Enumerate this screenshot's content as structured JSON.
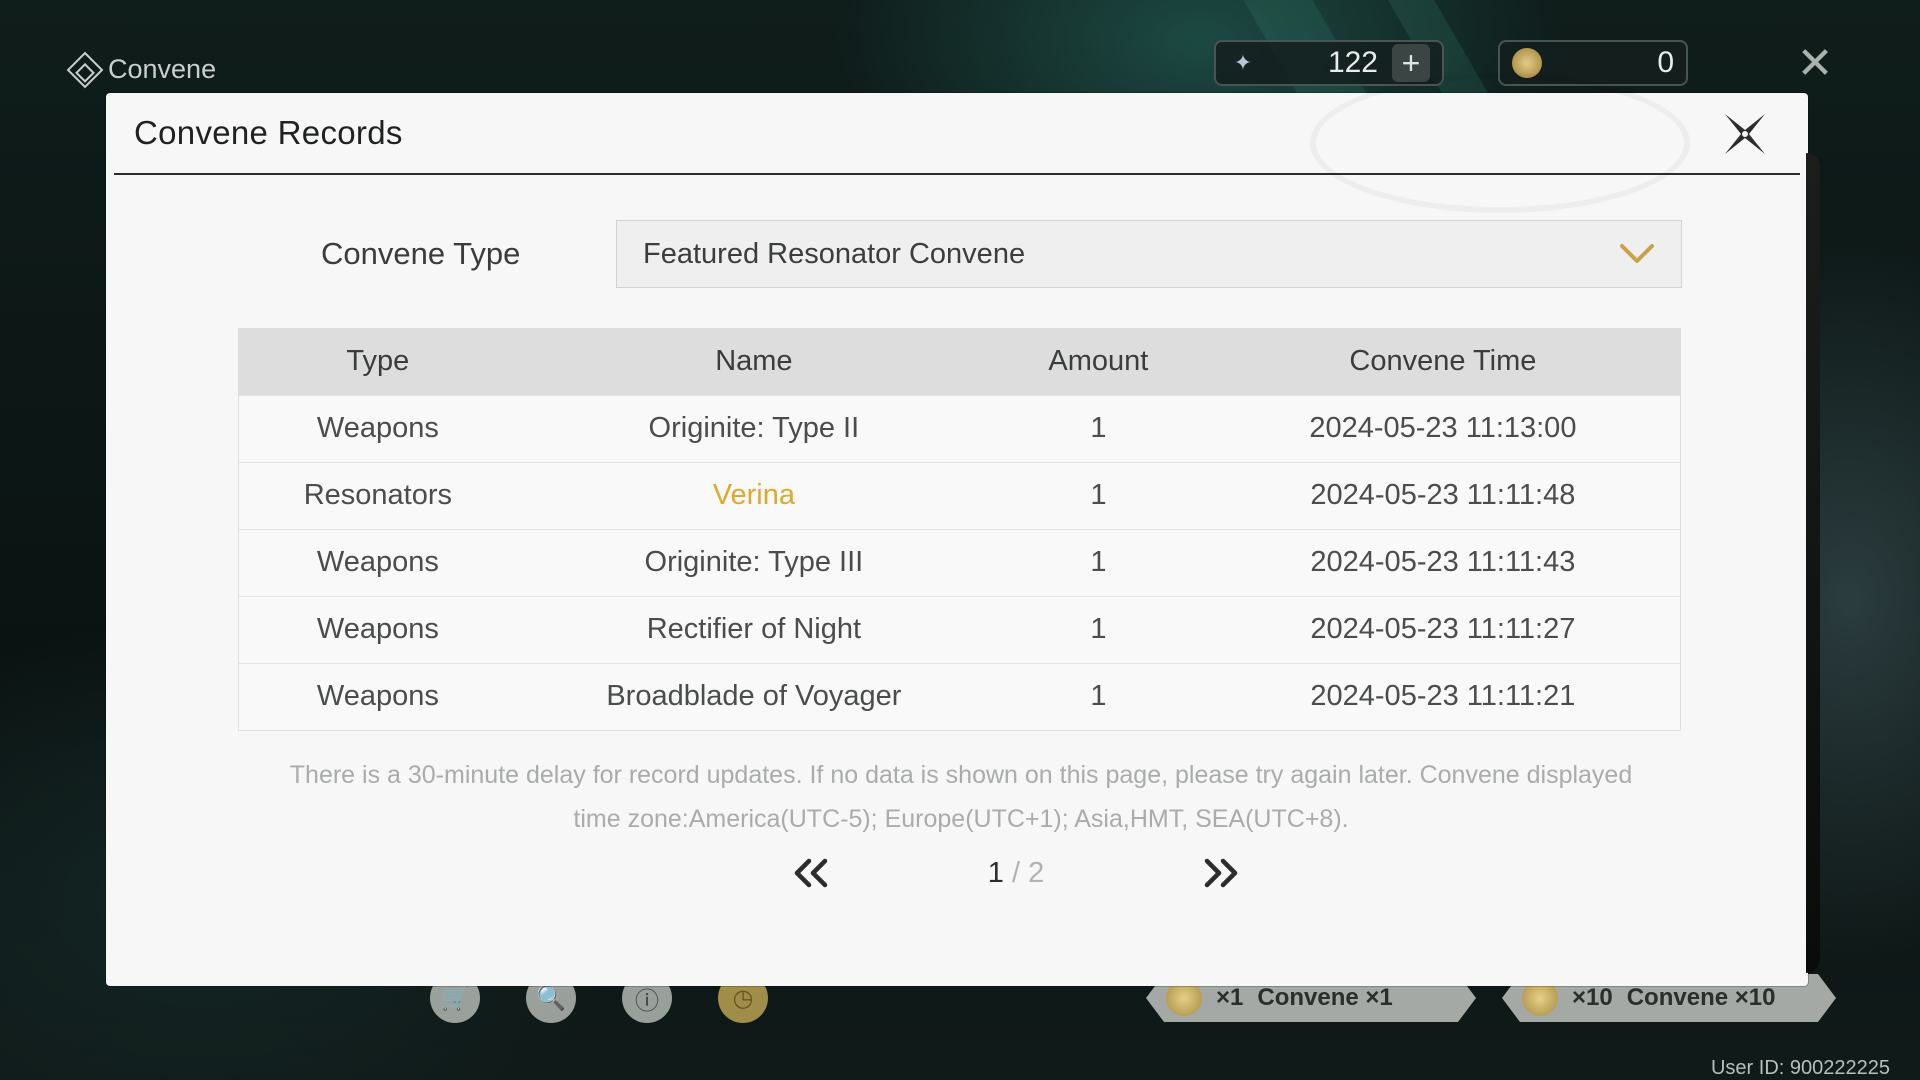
{
  "topbar": {
    "section_title": "Convene",
    "astrite_amount": "122",
    "tide_amount": "0"
  },
  "modal": {
    "title": "Convene Records",
    "convene_type_label": "Convene Type",
    "convene_type_value": "Featured Resonator Convene",
    "columns": [
      "Type",
      "Name",
      "Amount",
      "Convene Time"
    ],
    "rows": [
      {
        "type": "Weapons",
        "name": "Originite: Type II",
        "amount": "1",
        "time": "2024-05-23 11:13:00",
        "highlight": false
      },
      {
        "type": "Resonators",
        "name": "Verina",
        "amount": "1",
        "time": "2024-05-23 11:11:48",
        "highlight": true
      },
      {
        "type": "Weapons",
        "name": "Originite: Type III",
        "amount": "1",
        "time": "2024-05-23 11:11:43",
        "highlight": false
      },
      {
        "type": "Weapons",
        "name": "Rectifier of Night",
        "amount": "1",
        "time": "2024-05-23 11:11:27",
        "highlight": false
      },
      {
        "type": "Weapons",
        "name": "Broadblade of Voyager",
        "amount": "1",
        "time": "2024-05-23 11:11:21",
        "highlight": false
      }
    ],
    "notice_line1": "There is a 30-minute delay for record updates. If no data is shown on this page, please try again later. Convene displayed",
    "notice_line2": "time zone:America(UTC-5); Europe(UTC+1); Asia,HMT, SEA(UTC+8).",
    "pagination": {
      "current": "1",
      "separator": " / ",
      "total": "2"
    }
  },
  "bottom": {
    "pull_one_count": "×1",
    "pull_one_label": "Convene ×1",
    "pull_ten_count": "×10",
    "pull_ten_label": "Convene ×10",
    "user_id": "User ID: 900222225"
  },
  "colors": {
    "highlight_5star": "#e0a92a",
    "header_bg": "#dcdddc"
  }
}
